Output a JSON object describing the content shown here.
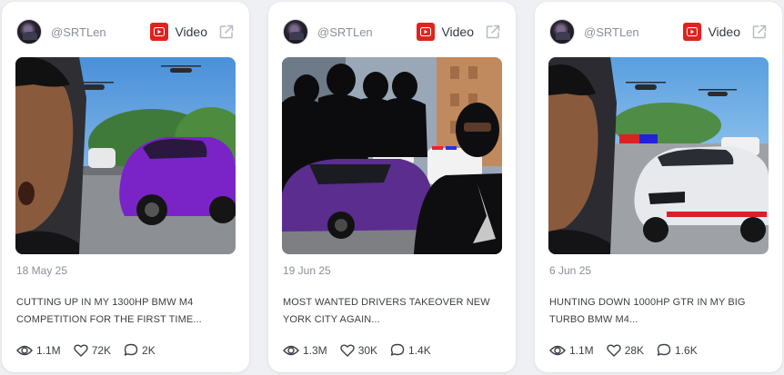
{
  "cards": [
    {
      "handle": "@SRTLen",
      "platform_label": "Video",
      "date": "18 May 25",
      "title": "CUTTING UP IN MY 1300HP BMW M4 COMPETITION FOR THE FIRST TIME...",
      "views": "1.1M",
      "likes": "72K",
      "comments": "2K"
    },
    {
      "handle": "@SRTLen",
      "platform_label": "Video",
      "date": "19 Jun 25",
      "title": "MOST WANTED DRIVERS TAKEOVER NEW YORK CITY AGAIN...",
      "views": "1.3M",
      "likes": "30K",
      "comments": "1.4K"
    },
    {
      "handle": "@SRTLen",
      "platform_label": "Video",
      "date": "6 Jun 25",
      "title": "HUNTING DOWN 1000HP GTR IN MY BIG TURBO BMW M4...",
      "views": "1.1M",
      "likes": "28K",
      "comments": "1.6K"
    }
  ],
  "icons": {
    "platform": "youtube-icon",
    "external": "external-link-icon",
    "views": "eye-icon",
    "likes": "heart-icon",
    "comments": "comment-icon"
  },
  "colors": {
    "youtube_red": "#e0231c",
    "muted_text": "#8a8f98",
    "body_text": "#3b3f46"
  }
}
